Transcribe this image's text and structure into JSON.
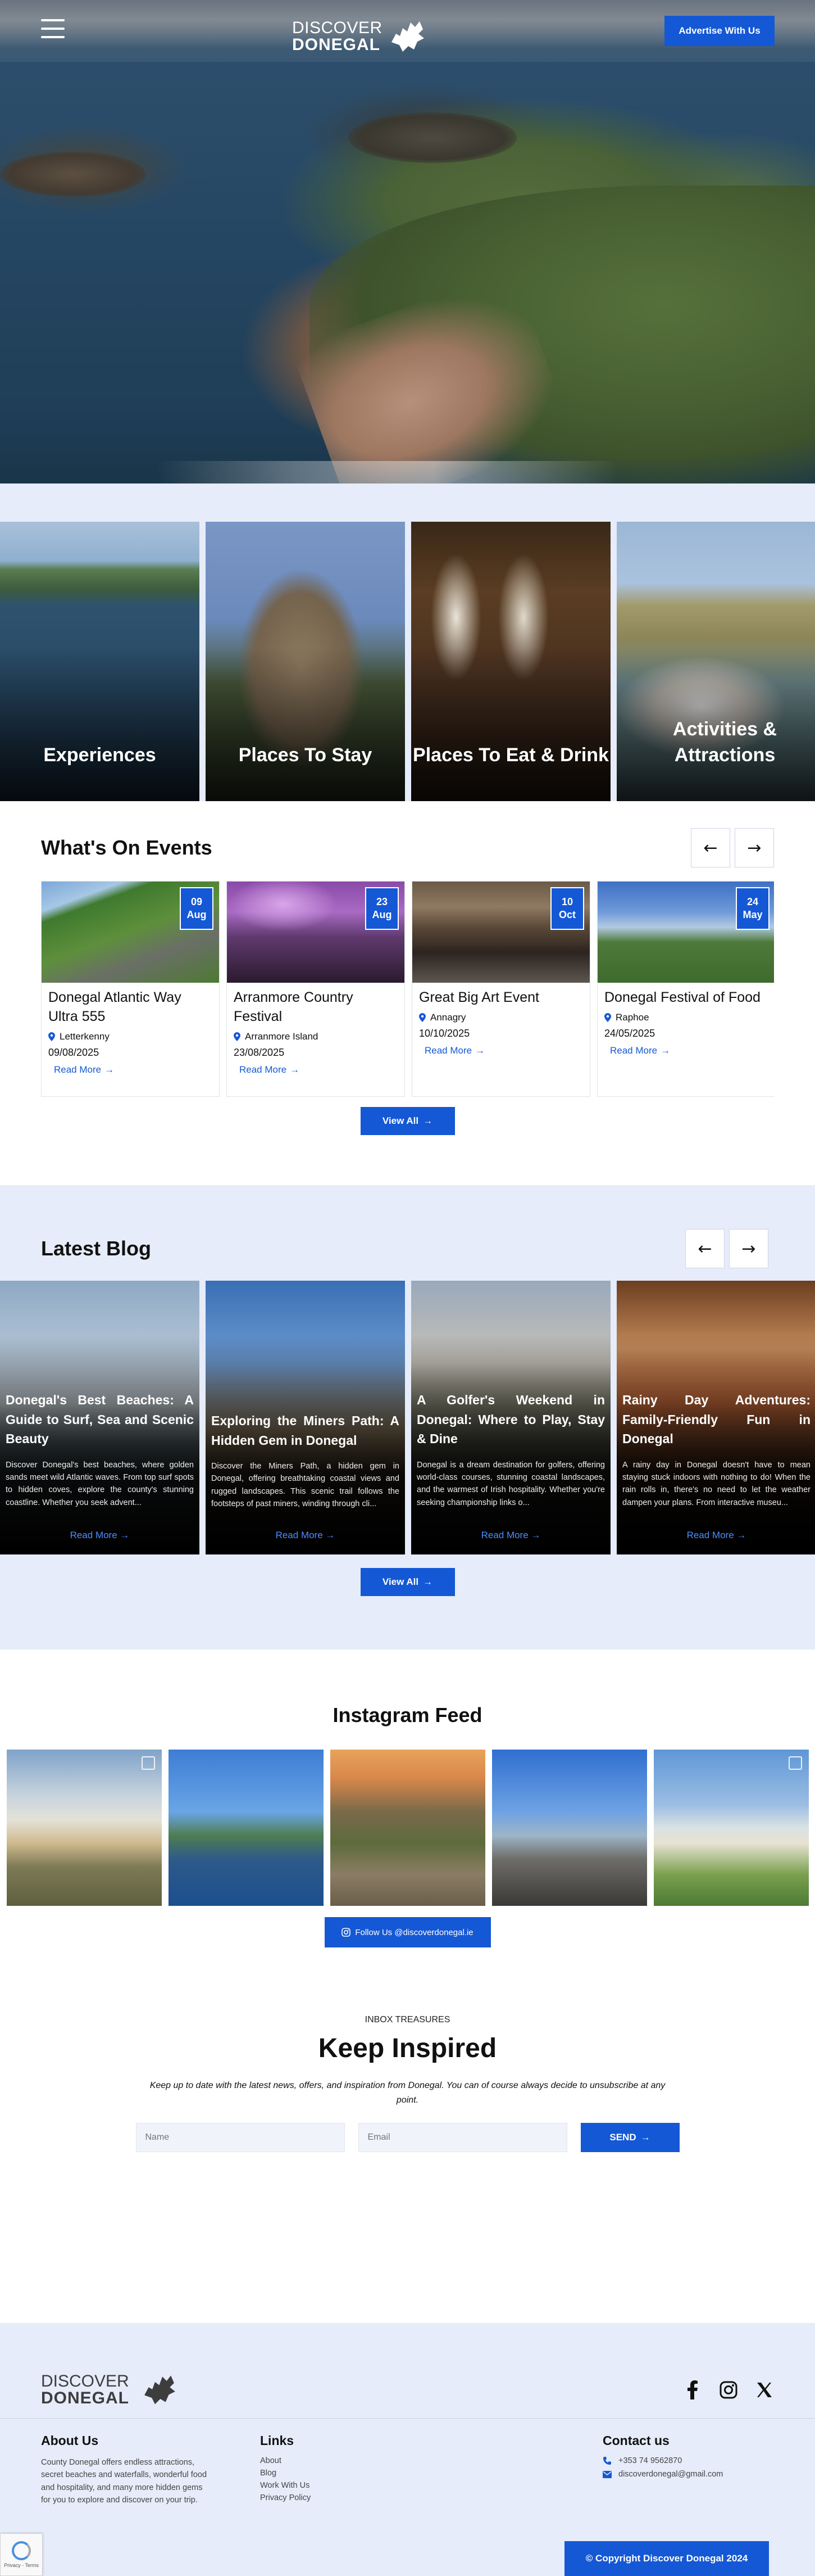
{
  "header": {
    "logo_line1": "DISCOVER",
    "logo_line2": "DONEGAL",
    "advertise_label": "Advertise With Us"
  },
  "categories": [
    {
      "label": "Experiences"
    },
    {
      "label": "Places To Stay"
    },
    {
      "label": "Places To Eat & Drink"
    },
    {
      "label": "Activities & Attractions"
    }
  ],
  "events": {
    "title": "What's On Events",
    "prev_icon": "arrow-left-icon",
    "next_icon": "arrow-right-icon",
    "items": [
      {
        "day": "09",
        "month": "Aug",
        "title": "Donegal Atlantic Way Ultra 555",
        "location": "Letterkenny",
        "date": "09/08/2025",
        "more": "Read More"
      },
      {
        "day": "23",
        "month": "Aug",
        "title": "Arranmore Country Festival",
        "location": "Arranmore Island",
        "date": "23/08/2025",
        "more": "Read More"
      },
      {
        "day": "10",
        "month": "Oct",
        "title": "Great Big Art Event",
        "location": "Annagry",
        "date": "10/10/2025",
        "more": "Read More"
      },
      {
        "day": "24",
        "month": "May",
        "title": "Donegal Festival of Food",
        "location": "Raphoe",
        "date": "24/05/2025",
        "more": "Read More"
      }
    ],
    "view_all": "View All"
  },
  "blog": {
    "title": "Latest Blog",
    "items": [
      {
        "title": "Donegal's Best Beaches: A Guide to Surf, Sea and Scenic Beauty",
        "excerpt": "Discover Donegal's best beaches, where golden sands meet wild Atlantic waves. From top surf spots to hidden coves, explore the county's stunning coastline. Whether you seek advent...",
        "more": "Read More"
      },
      {
        "title": "Exploring the Miners Path: A Hidden Gem in Donegal",
        "excerpt": "Discover the Miners Path, a hidden gem in Donegal, offering breathtaking coastal views and rugged landscapes. This scenic trail follows the footsteps of past miners, winding through cli...",
        "more": "Read More"
      },
      {
        "title": "A Golfer's Weekend in Donegal: Where to Play, Stay & Dine",
        "excerpt": "Donegal is a dream destination for golfers, offering world-class courses, stunning coastal landscapes, and the warmest of Irish hospitality. Whether you're seeking championship links o...",
        "more": "Read More"
      },
      {
        "title": "Rainy Day Adventures: Family-Friendly Fun in Donegal",
        "excerpt": "A rainy day in Donegal doesn't have to mean staying stuck indoors with nothing to do! When the rain rolls in, there's no need to let the weather dampen your plans. From interactive museu...",
        "more": "Read More"
      }
    ],
    "view_all": "View All"
  },
  "instagram": {
    "title": "Instagram Feed",
    "follow_label": "Follow Us @discoverdonegal.ie"
  },
  "newsletter": {
    "eyebrow": "INBOX TREASURES",
    "title": "Keep Inspired",
    "description": "Keep up to date with the latest news, offers, and inspiration from Donegal. You can of course always decide to unsubscribe at any point.",
    "name_placeholder": "Name",
    "email_placeholder": "Email",
    "send_label": "SEND"
  },
  "footer": {
    "logo_line1": "DISCOVER",
    "logo_line2": "DONEGAL",
    "about_title": "About Us",
    "about_text": "County Donegal offers endless attractions, secret beaches and waterfalls, wonderful food and hospitality, and many more hidden gems for you to explore and discover on your trip.",
    "links_title": "Links",
    "links": [
      "About",
      "Blog",
      "Work With Us",
      "Privacy Policy"
    ],
    "contact_title": "Contact us",
    "phone": "+353 74 9562870",
    "email": "discoverdonegal@gmail.com",
    "copyright": "© Copyright Discover Donegal 2024",
    "recaptcha_text": "Privacy - Terms"
  },
  "colors": {
    "brand_blue": "#1558d6",
    "section_bg": "#e6ecf9"
  }
}
